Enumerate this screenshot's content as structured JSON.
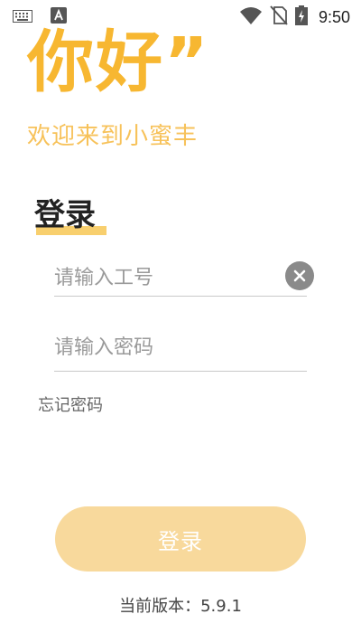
{
  "status_bar": {
    "time": "9:50",
    "left_icons": [
      "keyboard-icon",
      "text-a-icon"
    ],
    "right_icons": [
      "wifi-icon",
      "no-sim-icon",
      "battery-charging-icon"
    ]
  },
  "header": {
    "greeting": "你好”",
    "welcome": "欢迎来到小蜜丰"
  },
  "login": {
    "title": "登录",
    "employee_id": {
      "placeholder": "请输入工号",
      "value": ""
    },
    "password": {
      "placeholder": "请输入密码",
      "value": ""
    },
    "forgot_password": "忘记密码",
    "submit_label": "登录"
  },
  "footer": {
    "version": "当前版本：5.9.1"
  },
  "colors": {
    "accent": "#f7b731",
    "accent_light": "#f7c25a",
    "button_disabled": "#f8d99c",
    "underline": "#f8cf6e"
  }
}
